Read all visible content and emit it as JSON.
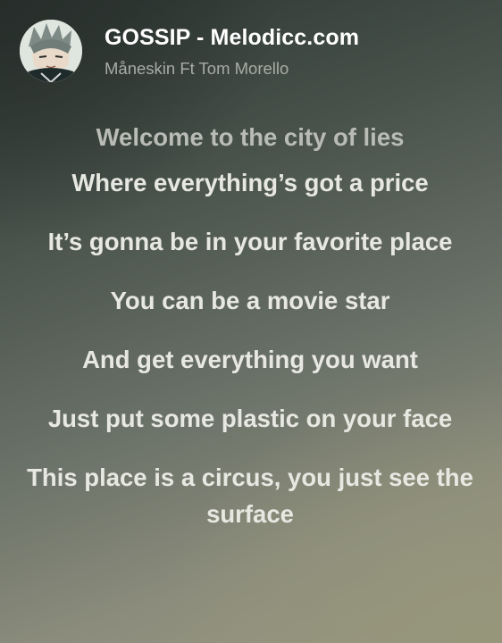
{
  "header": {
    "title": "GOSSIP - Melodicc.com",
    "artist": "Måneskin Ft Tom Morello",
    "avatar_icon": "anime-character-avatar"
  },
  "lyrics": {
    "lines": [
      "Welcome to the city of lies",
      "Where everything’s got a price",
      "It’s gonna be in your favorite place",
      "You can be a movie star",
      "And get everything you want",
      "Just put some plastic on your face",
      "This place is a circus, you just see the surface"
    ]
  },
  "colors": {
    "title": "#ffffff",
    "artist": "#a7aba6",
    "lyric": "#e8e8e2",
    "lyric_dim": "#b9bcb6"
  }
}
